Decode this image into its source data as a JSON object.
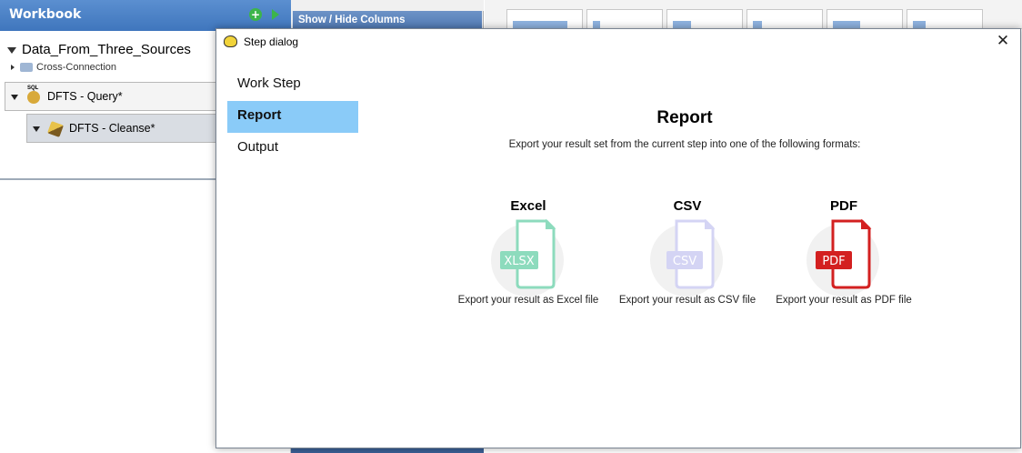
{
  "workbook": {
    "title": "Workbook",
    "root": "Data_From_Three_Sources",
    "sub": "Cross-Connection",
    "steps": [
      {
        "label": "DFTS - Query*"
      },
      {
        "label": "DFTS - Cleanse*"
      }
    ]
  },
  "middle_panel": {
    "title": "Show / Hide Columns"
  },
  "dialog": {
    "title": "Step dialog",
    "nav": [
      {
        "label": "Work Step"
      },
      {
        "label": "Report"
      },
      {
        "label": "Output"
      }
    ],
    "active_nav": "Report",
    "heading": "Report",
    "description": "Export your result set from the current step into one of the following formats:",
    "options": [
      {
        "label": "Excel",
        "badge": "XLSX",
        "desc": "Export your result as Excel file",
        "color": "#8ddbbd"
      },
      {
        "label": "CSV",
        "badge": "CSV",
        "desc": "Export your result as CSV file",
        "color": "#d4d4f4"
      },
      {
        "label": "PDF",
        "badge": "PDF",
        "desc": "Export your result as PDF file",
        "color": "#d32020"
      }
    ]
  }
}
